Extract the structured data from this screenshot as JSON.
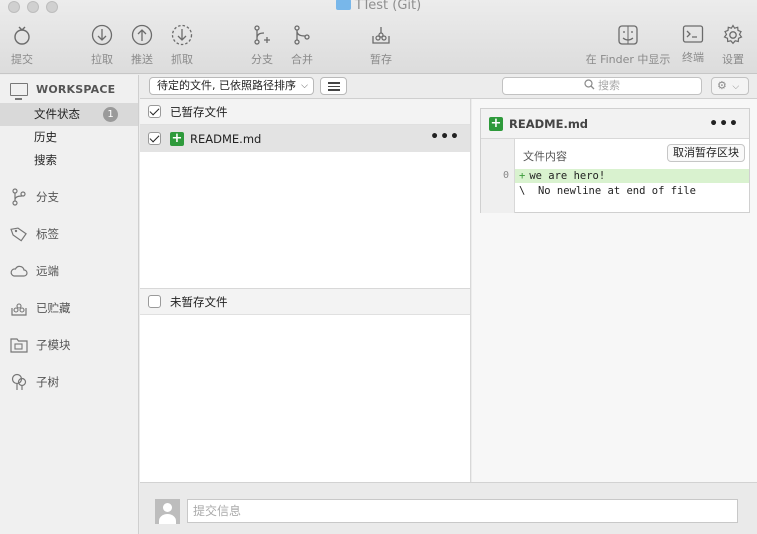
{
  "window": {
    "title": "TTest (Git)"
  },
  "toolbar": {
    "commit": "提交",
    "pull": "拉取",
    "push": "推送",
    "fetch": "抓取",
    "branch": "分支",
    "merge": "合并",
    "stash": "暂存",
    "show_in_finder": "在 Finder 中显示",
    "terminal": "终端",
    "settings": "设置"
  },
  "sidebar": {
    "workspace_title": "WORKSPACE",
    "items": [
      {
        "label": "文件状态",
        "badge": "1"
      },
      {
        "label": "历史"
      },
      {
        "label": "搜索"
      }
    ],
    "sections": [
      {
        "label": "分支",
        "icon": "branch-icon"
      },
      {
        "label": "标签",
        "icon": "tag-icon"
      },
      {
        "label": "远端",
        "icon": "cloud-icon"
      },
      {
        "label": "已贮藏",
        "icon": "stash-icon"
      },
      {
        "label": "子模块",
        "icon": "submodule-icon"
      },
      {
        "label": "子树",
        "icon": "subtree-icon"
      }
    ]
  },
  "subbar": {
    "sort_mode": "待定的文件, 已依照路径排序",
    "search_placeholder": "搜索"
  },
  "staged": {
    "header": "已暂存文件",
    "files": [
      {
        "name": "README.md",
        "status": "added"
      }
    ]
  },
  "unstaged": {
    "header": "未暂存文件"
  },
  "diff": {
    "filename": "README.md",
    "hunk_title": "文件内容",
    "unstage_hunk_label": "取消暂存区块",
    "line_number": "0",
    "added_line": "we are hero!",
    "no_newline": "\\  No newline at end of file"
  },
  "commit": {
    "placeholder": "提交信息"
  },
  "colors": {
    "added_green": "#2e9a3b",
    "added_line_bg": "#d9f2cf",
    "folder_blue": "#78b7ea"
  }
}
